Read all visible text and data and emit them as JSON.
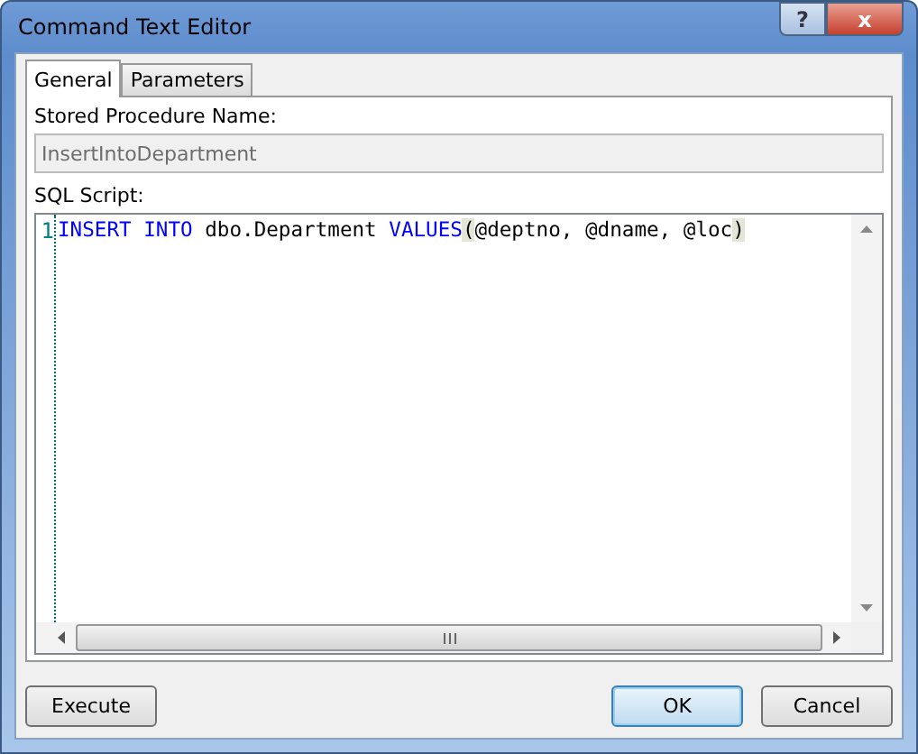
{
  "window": {
    "title": "Command Text Editor",
    "help_button": "?",
    "close_button": "x"
  },
  "tabs": [
    {
      "label": "General",
      "selected": true
    },
    {
      "label": "Parameters",
      "selected": false
    }
  ],
  "name_field": {
    "label": "Stored Procedure Name:",
    "value": "InsertIntoDepartment",
    "disabled": true
  },
  "script_editor": {
    "label": "SQL Script:",
    "lines": [
      {
        "number": "1",
        "tokens": [
          {
            "kind": "keyword",
            "text": "INSERT INTO"
          },
          {
            "kind": "plain",
            "text": " dbo.Department "
          },
          {
            "kind": "keyword",
            "text": "VALUES"
          },
          {
            "kind": "bracket",
            "text": "("
          },
          {
            "kind": "plain",
            "text": "@deptno, @dname, @loc"
          },
          {
            "kind": "bracket",
            "text": ")"
          }
        ]
      }
    ]
  },
  "buttons": [
    {
      "label": "Execute",
      "default": false
    },
    {
      "label": "OK",
      "default": true
    },
    {
      "label": "Cancel",
      "default": false
    }
  ]
}
